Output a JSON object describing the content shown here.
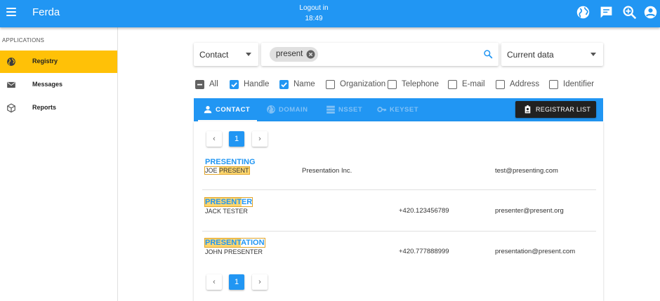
{
  "appbar": {
    "title": "Ferda",
    "logout_label": "Logout in",
    "logout_time": "18:49"
  },
  "sidebar": {
    "section_label": "APPLICATIONS",
    "items": [
      {
        "label": "Registry",
        "icon": "globe-icon",
        "active": true
      },
      {
        "label": "Messages",
        "icon": "envelope-icon",
        "active": false
      },
      {
        "label": "Reports",
        "icon": "cube-icon",
        "active": false
      }
    ]
  },
  "filters": {
    "object_type": "Contact",
    "search_chip": "present",
    "search_value": "",
    "history": "Current data"
  },
  "fields": [
    {
      "label": "All",
      "state": "indeterminate"
    },
    {
      "label": "Handle",
      "state": "checked"
    },
    {
      "label": "Name",
      "state": "checked"
    },
    {
      "label": "Organization",
      "state": "unchecked"
    },
    {
      "label": "Telephone",
      "state": "unchecked"
    },
    {
      "label": "E-mail",
      "state": "unchecked"
    },
    {
      "label": "Address",
      "state": "unchecked"
    },
    {
      "label": "Identifier",
      "state": "unchecked"
    }
  ],
  "tabs": [
    {
      "label": "CONTACT",
      "icon": "person-icon",
      "active": true
    },
    {
      "label": "DOMAIN",
      "icon": "globe-icon",
      "active": false
    },
    {
      "label": "NSSET",
      "icon": "server-icon",
      "active": false
    },
    {
      "label": "KEYSET",
      "icon": "key-icon",
      "active": false
    }
  ],
  "registrar_button": "REGISTRAR LIST",
  "pagination": {
    "current": "1",
    "prev": "‹",
    "next": "›"
  },
  "results": [
    {
      "handle_plain_before": "PRESENTING",
      "handle_hl": "",
      "handle_plain_after": "",
      "name_before": "JOE ",
      "name_hl": "PRESENT",
      "name_after": "",
      "organization": "Presentation Inc.",
      "telephone": "",
      "email": "test@presenting.com"
    },
    {
      "handle_plain_before": "",
      "handle_hl": "PRESENT",
      "handle_plain_after": "ER",
      "name_before": "JACK TESTER",
      "name_hl": "",
      "name_after": "",
      "organization": "",
      "telephone": "+420.123456789",
      "email": "presenter@present.org"
    },
    {
      "handle_plain_before": "",
      "handle_hl": "PRESENT",
      "handle_plain_after": "ATION",
      "name_before": "JOHN PRESENTER",
      "name_hl": "",
      "name_after": "",
      "organization": "",
      "telephone": "+420.777888999",
      "email": "presentation@present.com"
    }
  ],
  "colors": {
    "primary": "#2196f3",
    "sidebar_active": "#ffc107",
    "highlight": "#fdd66e",
    "dark_button": "#212121"
  }
}
